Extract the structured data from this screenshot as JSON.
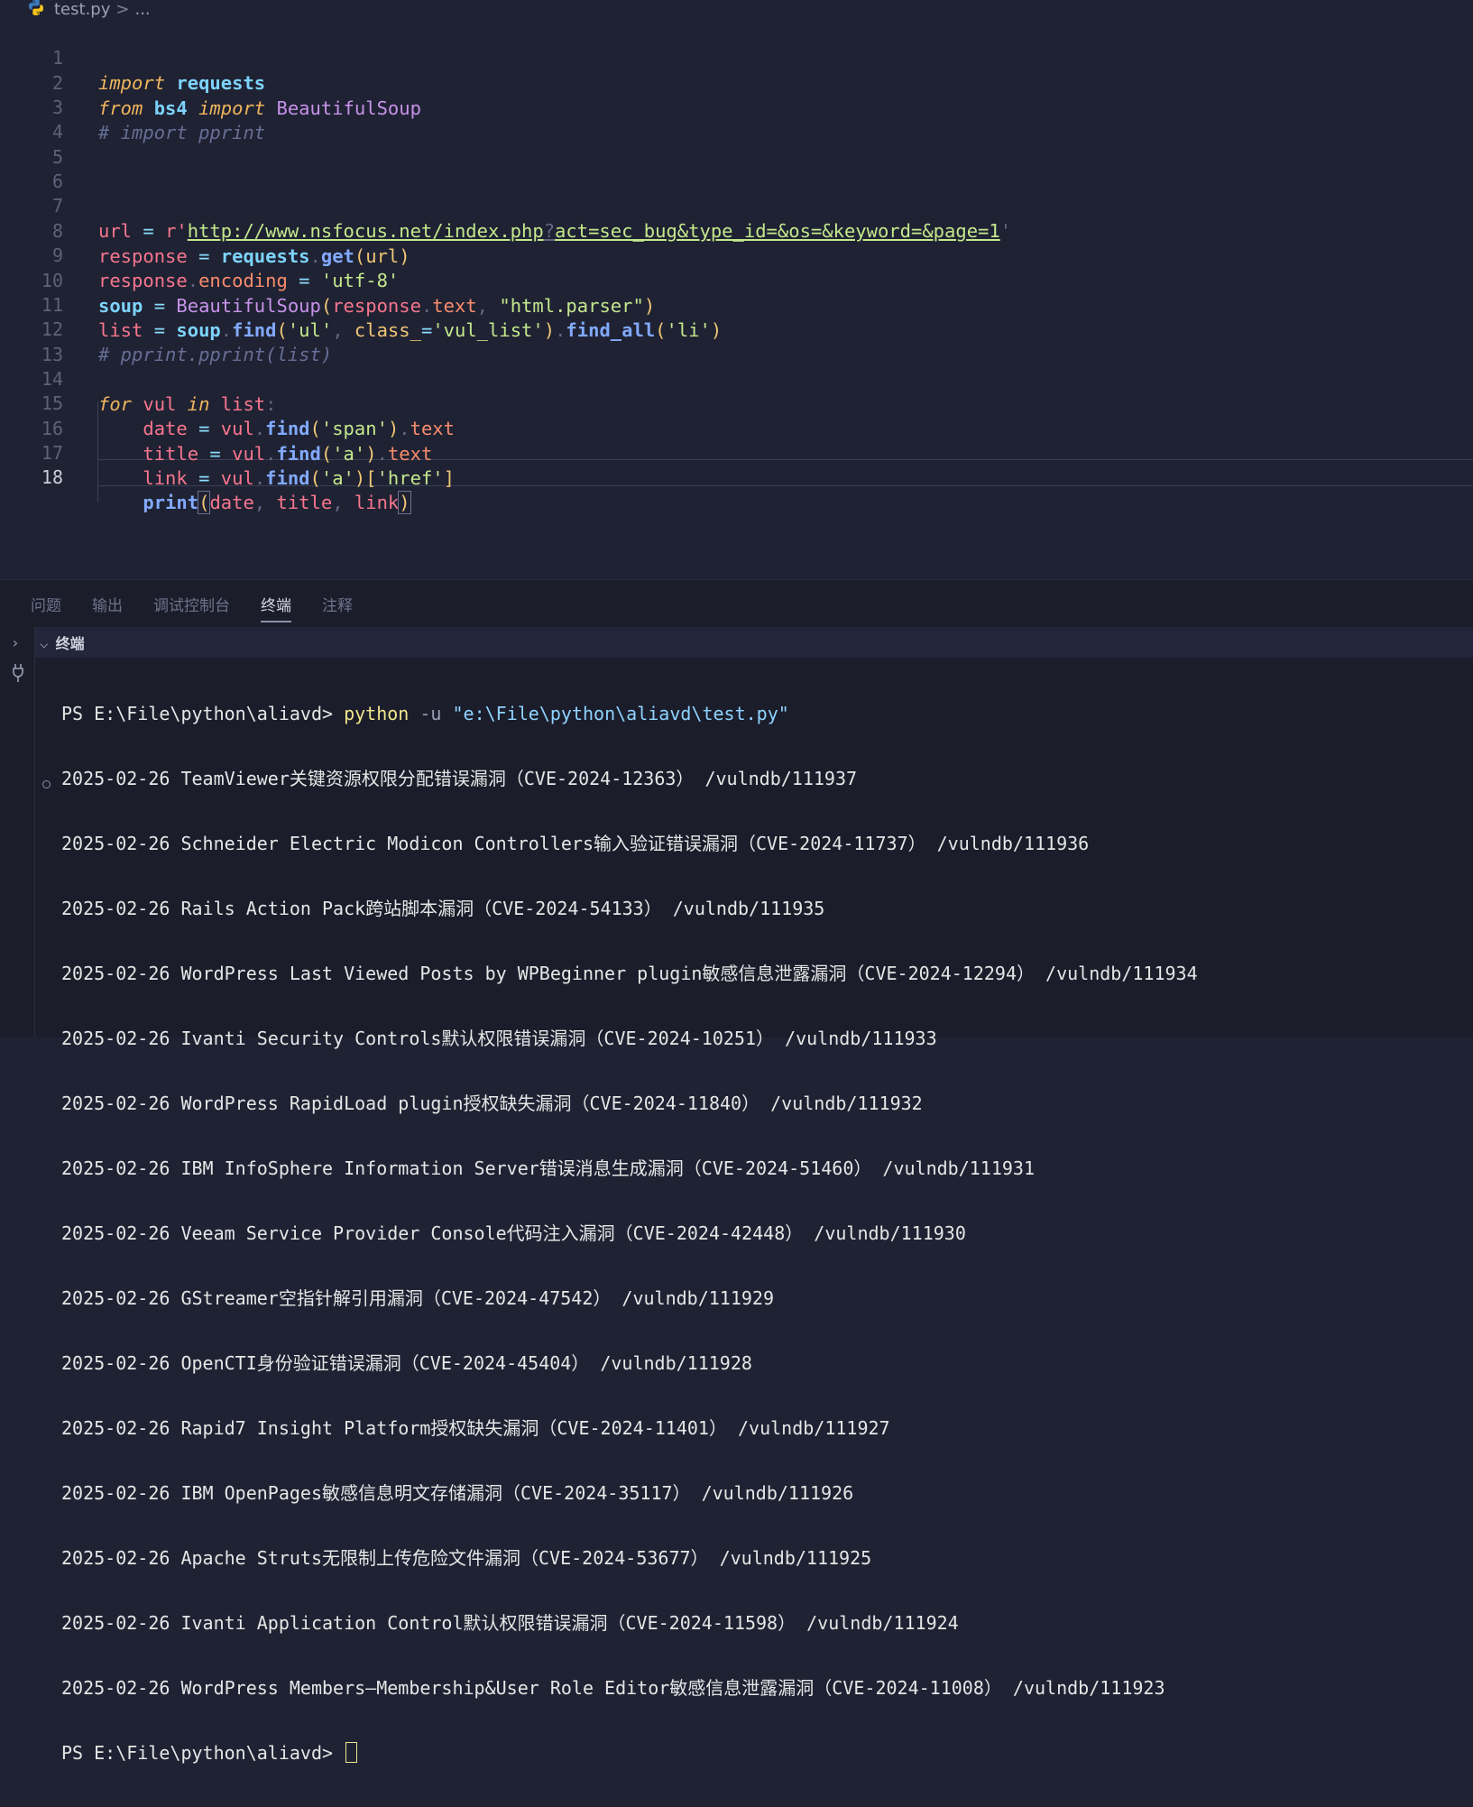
{
  "breadcrumb": {
    "file": "test.py",
    "separator": ">",
    "more": "..."
  },
  "editor": {
    "line_numbers": [
      "1",
      "2",
      "3",
      "4",
      "5",
      "6",
      "7",
      "8",
      "9",
      "10",
      "11",
      "12",
      "13",
      "14",
      "15",
      "16",
      "17",
      "18"
    ],
    "current_line": "18",
    "code": {
      "l1_kw": "import",
      "l1_mod": "requests",
      "l2_kw": "from",
      "l2_mod": "bs4",
      "l2_kw2": "import",
      "l2_cls": "BeautifulSoup",
      "l3": "# import pprint",
      "l7_var": "url",
      "l7_eq": " = ",
      "l7_prefix": "r'",
      "l7_url1": "http://www.nsfocus.net/index.php",
      "l7_q": "?",
      "l7_url2": "act=sec_bug&type_id=&os=&keyword=&page=1",
      "l7_end": "'",
      "l8_var": "response",
      "l8_eq": " = ",
      "l8_mod": "requests",
      "l8_dot": ".",
      "l8_fn": "get",
      "l8_args": "(url)",
      "l9_var": "response",
      "l9_dot": ".",
      "l9_attr": "encoding",
      "l9_eq": " = ",
      "l9_str": "'utf-8'",
      "l10_var": "soup",
      "l10_eq": " = ",
      "l10_cls": "BeautifulSoup",
      "l10_p1": "(",
      "l10_a1": "response",
      "l10_dot": ".",
      "l10_a2": "text",
      "l10_comma": ", ",
      "l10_str": "\"html.parser\"",
      "l10_p2": ")",
      "l11_var": "list",
      "l11_eq": " = ",
      "l11_mod": "soup",
      "l11_dot": ".",
      "l11_fn": "find",
      "l11_p1": "(",
      "l11_s1": "'ul'",
      "l11_comma": ", ",
      "l11_kwarg": "class_",
      "l11_eq2": "=",
      "l11_s2": "'vul_list'",
      "l11_p2": ")",
      "l11_dot2": ".",
      "l11_fn2": "find_all",
      "l11_p3": "(",
      "l11_s3": "'li'",
      "l11_p4": ")",
      "l12": "# pprint.pprint(list)",
      "l14_kw": "for",
      "l14_v": " vul ",
      "l14_kw2": "in",
      "l14_v2": " list",
      "l14_colon": ":",
      "l15_var": "date",
      "l15_eq": " = ",
      "l15_obj": "vul",
      "l15_dot": ".",
      "l15_fn": "find",
      "l15_p1": "(",
      "l15_s": "'span'",
      "l15_p2": ")",
      "l15_dot2": ".",
      "l15_attr": "text",
      "l16_var": "title",
      "l16_eq": " = ",
      "l16_obj": "vul",
      "l16_dot": ".",
      "l16_fn": "find",
      "l16_p1": "(",
      "l16_s": "'a'",
      "l16_p2": ")",
      "l16_dot2": ".",
      "l16_attr": "text",
      "l17_var": "link",
      "l17_eq": " = ",
      "l17_obj": "vul",
      "l17_dot": ".",
      "l17_fn": "find",
      "l17_p1": "(",
      "l17_s": "'a'",
      "l17_p2": ")",
      "l17_b1": "[",
      "l17_s2": "'href'",
      "l17_b2": "]",
      "l18_fn": "print",
      "l18_p1": "(",
      "l18_a1": "date",
      "l18_c1": ", ",
      "l18_a2": "title",
      "l18_c2": ", ",
      "l18_a3": "link",
      "l18_p2": ")"
    }
  },
  "panel": {
    "tabs": [
      "问题",
      "输出",
      "调试控制台",
      "终端",
      "注释"
    ],
    "active_tab": "终端",
    "terminal_title": "终端",
    "prompt": "PS E:\\File\\python\\aliavd> ",
    "command": "python",
    "flag": " -u ",
    "script": "\"e:\\File\\python\\aliavd\\test.py\"",
    "output": [
      "2025-02-26 TeamViewer关键资源权限分配错误漏洞（CVE-2024-12363） /vulndb/111937",
      "2025-02-26 Schneider Electric Modicon Controllers输入验证错误漏洞（CVE-2024-11737） /vulndb/111936",
      "2025-02-26 Rails Action Pack跨站脚本漏洞（CVE-2024-54133） /vulndb/111935",
      "2025-02-26 WordPress Last Viewed Posts by WPBeginner plugin敏感信息泄露漏洞（CVE-2024-12294） /vulndb/111934",
      "2025-02-26 Ivanti Security Controls默认权限错误漏洞（CVE-2024-10251） /vulndb/111933",
      "2025-02-26 WordPress RapidLoad plugin授权缺失漏洞（CVE-2024-11840） /vulndb/111932",
      "2025-02-26 IBM InfoSphere Information Server错误消息生成漏洞（CVE-2024-51460） /vulndb/111931",
      "2025-02-26 Veeam Service Provider Console代码注入漏洞（CVE-2024-42448） /vulndb/111930",
      "2025-02-26 GStreamer空指针解引用漏洞（CVE-2024-47542） /vulndb/111929",
      "2025-02-26 OpenCTI身份验证错误漏洞（CVE-2024-45404） /vulndb/111928",
      "2025-02-26 Rapid7 Insight Platform授权缺失漏洞（CVE-2024-11401） /vulndb/111927",
      "2025-02-26 IBM OpenPages敏感信息明文存储漏洞（CVE-2024-35117） /vulndb/111926",
      "2025-02-26 Apache Struts无限制上传危险文件漏洞（CVE-2024-53677） /vulndb/111925",
      "2025-02-26 Ivanti Application Control默认权限错误漏洞（CVE-2024-11598） /vulndb/111924",
      "2025-02-26 WordPress Members–Membership&User Role Editor敏感信息泄露漏洞（CVE-2024-11008） /vulndb/111923"
    ],
    "final_prompt": "PS E:\\File\\python\\aliavd> "
  }
}
